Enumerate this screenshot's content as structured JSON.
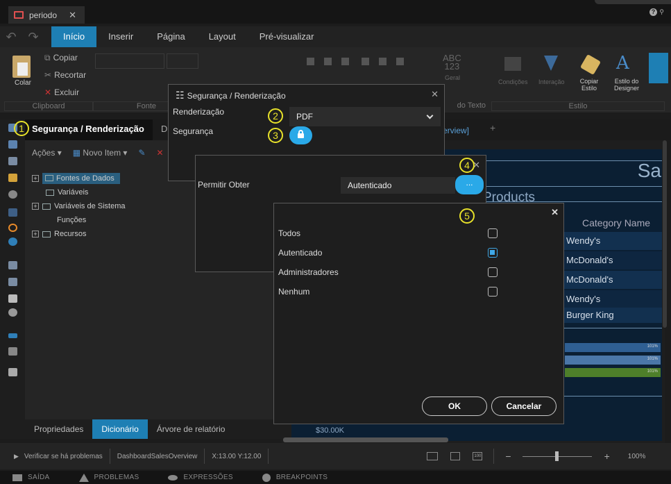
{
  "window": {
    "tab_title": "periodo"
  },
  "ribbon": {
    "tabs": [
      "Início",
      "Inserir",
      "Página",
      "Layout",
      "Pré-visualizar"
    ],
    "active_tab": "Início",
    "clipboard": {
      "paste": "Colar",
      "copy": "Copiar",
      "cut": "Recortar",
      "delete": "Excluir"
    },
    "ghost_labels": {
      "general": "Geral",
      "conditions": "Condições",
      "interaction": "Interação"
    },
    "copy_style": "Copiar Estilo",
    "designer_style": "Estilo do Designer",
    "sections": {
      "clipboard": "Clipboard",
      "font": "Fonte",
      "text_format": "do Texto",
      "style": "Estilo"
    }
  },
  "page_tabs": {
    "active": "Segurança / Renderização",
    "other_initial": "D",
    "overview": "verview]"
  },
  "dictionary": {
    "actions": "Ações",
    "new_item": "Novo Item",
    "tree": [
      {
        "label": "Fontes de Dados",
        "expandable": true,
        "selected": true
      },
      {
        "label": "Variáveis",
        "expandable": false,
        "selected": false
      },
      {
        "label": "Variáveis de Sistema",
        "expandable": true,
        "selected": false
      },
      {
        "label": "Funções",
        "expandable": false,
        "selected": false
      },
      {
        "label": "Recursos",
        "expandable": true,
        "selected": false
      }
    ]
  },
  "bottom_tabs": [
    "Propriedades",
    "Dicionário",
    "Árvore de relatório"
  ],
  "bottom_active": "Dicionário",
  "report": {
    "title_fragment": "Sa",
    "products_fragment": "Products",
    "category_header": "Category Name",
    "categories": [
      "Wendy's",
      "McDonald's",
      "McDonald's",
      "Wendy's",
      "Burger King"
    ],
    "bar_labels": [
      "101%",
      "101%",
      "101%"
    ],
    "axis_label": "$30.00K"
  },
  "status": {
    "check_problems": "Verificar se há problemas",
    "report_name": "DashboardSalesOverview",
    "coords": "X:13.00 Y:12.00",
    "zoom": "100%",
    "zoom_fraction": 0.47
  },
  "bottom_bar": [
    "SAÍDA",
    "PROBLEMAS",
    "EXPRESSÕES",
    "BREAKPOINTS"
  ],
  "annotations": [
    "1",
    "2",
    "3",
    "4",
    "5"
  ],
  "dialog_security": {
    "title": "Segurança / Renderização",
    "rendering_label": "Renderização",
    "rendering_value": "PDF",
    "security_label": "Segurança"
  },
  "dialog_permission": {
    "label": "Permitir Obter",
    "value": "Autenticado",
    "button": "..."
  },
  "dialog_roles": {
    "options": [
      {
        "label": "Todos",
        "checked": false
      },
      {
        "label": "Autenticado",
        "checked": true
      },
      {
        "label": "Administradores",
        "checked": false
      },
      {
        "label": "Nenhum",
        "checked": false
      }
    ],
    "ok": "OK",
    "cancel": "Cancelar"
  },
  "colors": {
    "accent": "#1e7fb4",
    "button_blue": "#2aa9e8",
    "annotation": "#e8e22a"
  }
}
